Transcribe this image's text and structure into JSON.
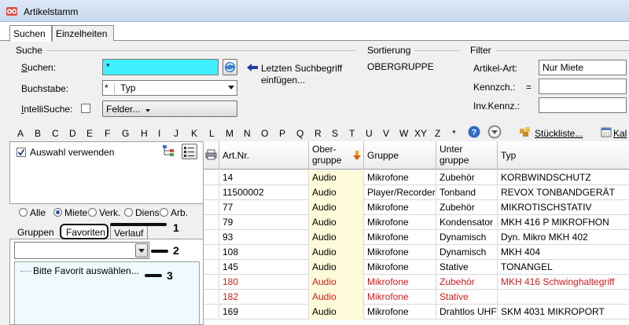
{
  "window": {
    "title": "Artikelstamm"
  },
  "tabs": [
    "Suchen",
    "Einzelheiten"
  ],
  "suche": {
    "group_label": "Suche",
    "suchen_label": "Suchen:",
    "suchen_value": "*",
    "last_search_hint": "Letzten Suchbegriff einfügen...",
    "buchstabe_label": "Buchstabe:",
    "buchstabe_prefix": "*",
    "buchstabe_value": "Typ",
    "intellisuche_label": "IntelliSuche:",
    "felder_button": "Felder..."
  },
  "sortierung": {
    "group_label": "Sortierung",
    "value": "OBERGRUPPE"
  },
  "filter": {
    "group_label": "Filter",
    "artikel_art_label": "Artikel-Art:",
    "artikel_art_value": "Nur Miete",
    "kennzch_label": "Kennzch.:",
    "kennzch_op": "=",
    "inv_kennz_label": "Inv.Kennz.:"
  },
  "alphabet": [
    "A",
    "B",
    "C",
    "D",
    "E",
    "F",
    "G",
    "H",
    "I",
    "J",
    "K",
    "L",
    "M",
    "N",
    "O",
    "P",
    "Q",
    "R",
    "S",
    "T",
    "U",
    "V",
    "W",
    "XY",
    "Z",
    "*"
  ],
  "toolbar": {
    "stueckliste": "Stückliste...",
    "kal": "Kal"
  },
  "left": {
    "auswahl_label": "Auswahl verwenden",
    "radios": [
      "Alle",
      "Miete",
      "Verk.",
      "Diens",
      "Arb."
    ],
    "selected_radio": "Miete",
    "subtabs": [
      "Gruppen",
      "Favoriten",
      "Verlauf"
    ],
    "favorit_placeholder": "Bitte Favorit auswählen...",
    "annotations": [
      "1",
      "2",
      "3"
    ]
  },
  "grid": {
    "headers": [
      "Art.Nr.",
      "Ober-\ngruppe",
      "Gruppe",
      "Unter\ngruppe",
      "Typ"
    ],
    "rows": [
      {
        "art": "14",
        "ober": "Audio",
        "gruppe": "Mikrofone",
        "unter": "Zubehör",
        "typ": "KORBWINDSCHUTZ",
        "red": false
      },
      {
        "art": "11500002",
        "ober": "Audio",
        "gruppe": "Player/Recorder",
        "unter": "Tonband",
        "typ": "REVOX TONBANDGERÄT",
        "red": false
      },
      {
        "art": "77",
        "ober": "Audio",
        "gruppe": "Mikrofone",
        "unter": "Zubehör",
        "typ": "MIKROTISCHSTATIV",
        "red": false
      },
      {
        "art": "79",
        "ober": "Audio",
        "gruppe": "Mikrofone",
        "unter": "Kondensator",
        "typ": "MKH 416 P MIKROFHON",
        "red": false
      },
      {
        "art": "93",
        "ober": "Audio",
        "gruppe": "Mikrofone",
        "unter": "Dynamisch",
        "typ": "Dyn. Mikro MKH 402",
        "red": false
      },
      {
        "art": "108",
        "ober": "Audio",
        "gruppe": "Mikrofone",
        "unter": "Dynamisch",
        "typ": "MKH 404",
        "red": false
      },
      {
        "art": "145",
        "ober": "Audio",
        "gruppe": "Mikrofone",
        "unter": "Stative",
        "typ": "TONANGEL",
        "red": false
      },
      {
        "art": "180",
        "ober": "Audio",
        "gruppe": "Mikrofone",
        "unter": "Zubehör",
        "typ": "MKH 416 Schwinghaltegriff",
        "red": true
      },
      {
        "art": "182",
        "ober": "Audio",
        "gruppe": "Mikrofone",
        "unter": "Stative",
        "typ": "",
        "red": true
      },
      {
        "art": "169",
        "ober": "Audio",
        "gruppe": "Mikrofone",
        "unter": "Drahtlos UHF",
        "typ": "SKM 4031 MIKROPORT",
        "red": false
      }
    ]
  }
}
